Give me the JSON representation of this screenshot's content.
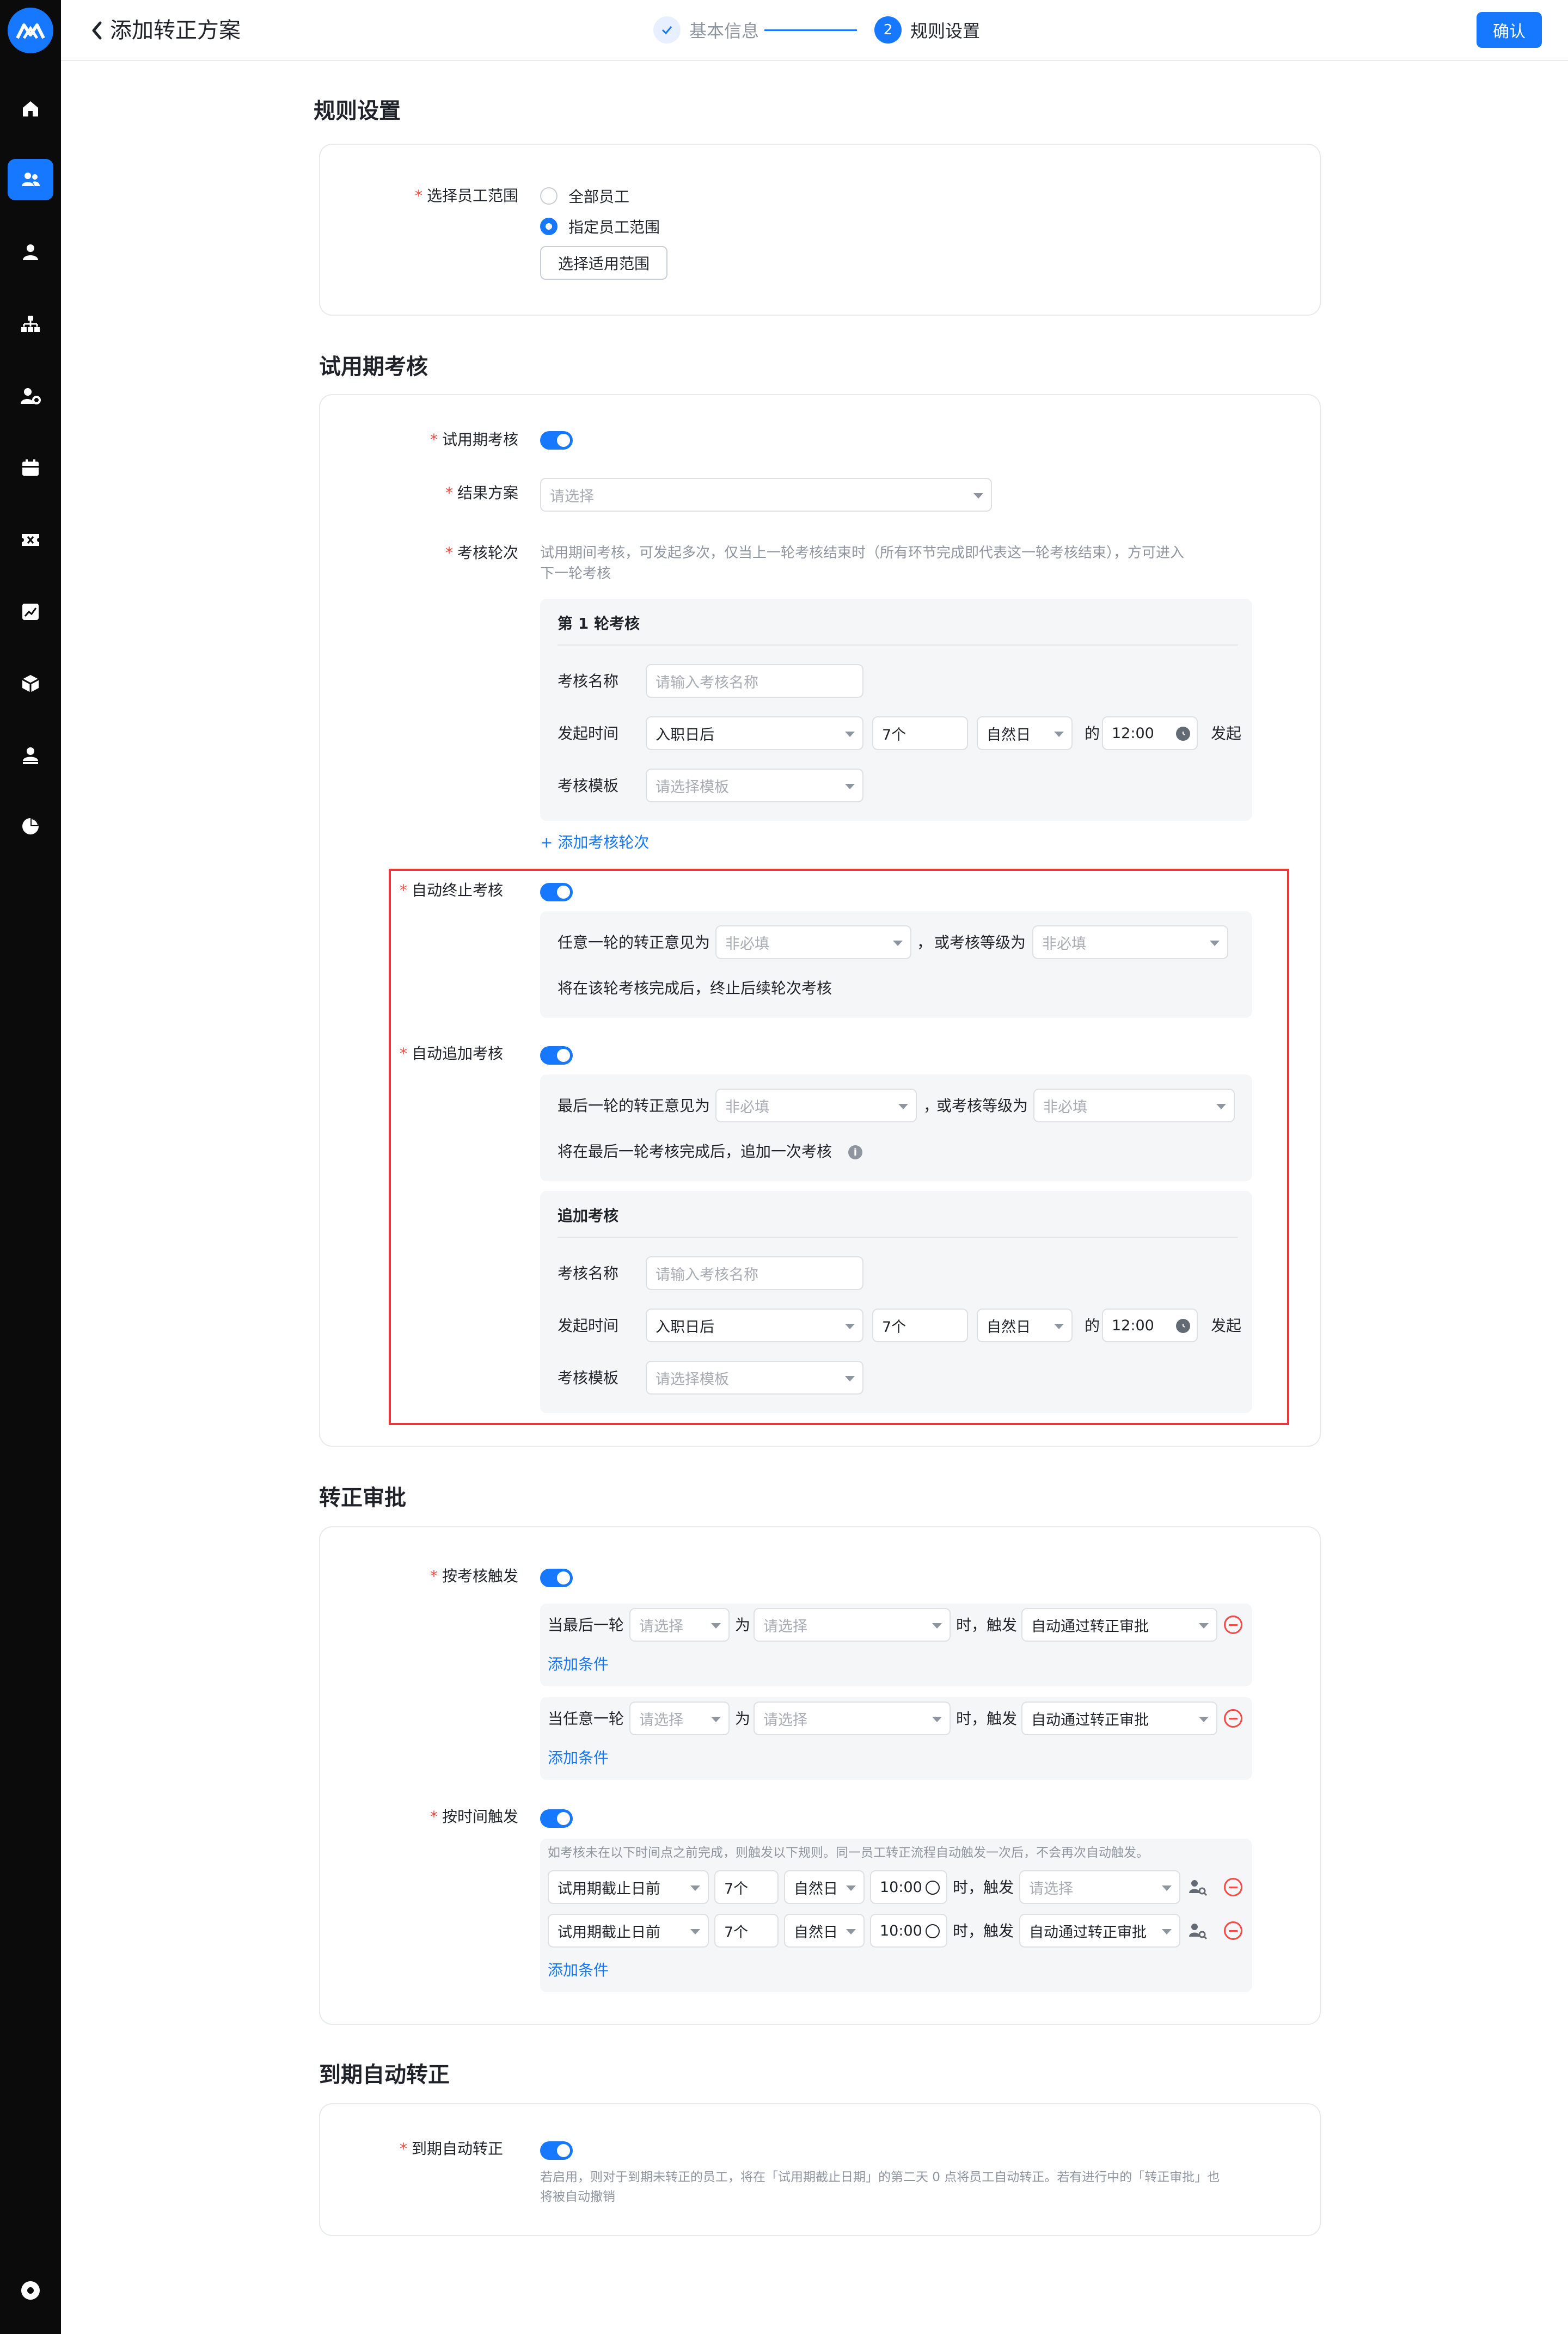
{
  "header": {
    "title": "添加转正方案",
    "step1": "基本信息",
    "step2_num": "2",
    "step2": "规则设置",
    "confirm": "确认"
  },
  "sidebar": {
    "icons": [
      "logo-icon",
      "home-icon",
      "people-icon",
      "person-icon",
      "org-chart-icon",
      "person-settings-icon",
      "calendar-icon",
      "ticket-icon",
      "chart-icon",
      "box-icon",
      "person-badge-icon",
      "pie-chart-icon",
      "settings-icon"
    ]
  },
  "rules": {
    "title": "规则设置",
    "scope_label": "选择员工范围",
    "opt_all": "全部员工",
    "opt_specified": "指定员工范围",
    "scope_btn": "选择适用范围"
  },
  "probation": {
    "title": "试用期考核",
    "review_label": "试用期考核",
    "result_label": "结果方案",
    "result_placeholder": "请选择",
    "rounds_label": "考核轮次",
    "rounds_hint_1": "试用期间考核，可发起多次，仅当上一轮考核结束时（所有环节完成即代表这一轮考核结束），方可进入",
    "rounds_hint_2": "下一轮考核",
    "round1": {
      "title": "第 1 轮考核",
      "name_label": "考核名称",
      "name_placeholder": "请输入考核名称",
      "time_label": "发起时间",
      "time_base": "入职日后",
      "time_count": "7个",
      "time_unit": "自然日",
      "of": "的",
      "time_clock": "12:00",
      "launch": "发起",
      "tpl_label": "考核模板",
      "tpl_placeholder": "请选择模板"
    },
    "add_round": "添加考核轮次",
    "auto_stop_label": "自动终止考核",
    "stop_any": "任意一轮的转正意见为",
    "stop_any_placeholder": "非必填",
    "comma": "，",
    "or_level": "或考核等级为",
    "or_level_placeholder": "非必填",
    "stop_desc": "将在该轮考核完成后，终止后续轮次考核",
    "auto_add_label": "自动追加考核",
    "add_last": "最后一轮的转正意见为",
    "add_last_placeholder": "非必填",
    "add_or_level": "或考核等级为",
    "add_or_level_placeholder": "非必填",
    "add_desc": "将在最后一轮考核完成后，追加一次考核",
    "extra": {
      "title": "追加考核",
      "name_label": "考核名称",
      "name_placeholder": "请输入考核名称",
      "time_label": "发起时间",
      "time_base": "入职日后",
      "time_count": "7个",
      "time_unit": "自然日",
      "of": "的",
      "time_clock": "12:00",
      "launch": "发起",
      "tpl_label": "考核模板",
      "tpl_placeholder": "请选择模板"
    }
  },
  "approval": {
    "title": "转正审批",
    "by_review_label": "按考核触发",
    "cond1": {
      "prefix": "当最后一轮",
      "sel1": "请选择",
      "is": "为",
      "sel2": "请选择",
      "then": "时，触发",
      "action": "自动通过转正审批",
      "add": "添加条件"
    },
    "cond2": {
      "prefix": "当任意一轮",
      "sel1": "请选择",
      "is": "为",
      "sel2": "请选择",
      "then": "时，触发",
      "action": "自动通过转正审批",
      "add": "添加条件"
    },
    "by_time_label": "按时间触发",
    "time_hint": "如考核未在以下时间点之前完成，则触发以下规则。同一员工转正流程自动触发一次后，不会再次自动触发。",
    "trow1": {
      "base": "试用期截止日前",
      "count": "7个",
      "unit": "自然日",
      "clock": "10:00",
      "then": "时，触发",
      "action": "请选择"
    },
    "trow2": {
      "base": "试用期截止日前",
      "count": "7个",
      "unit": "自然日",
      "clock": "10:00",
      "then": "时，触发",
      "action": "自动通过转正审批"
    },
    "add": "添加条件"
  },
  "auto": {
    "title": "到期自动转正",
    "label": "到期自动转正",
    "desc1": "若启用，则对于到期未转正的员工，将在「试用期截止日期」的第二天 0 点将员工自动转正。若有进行中的「转正审批」也",
    "desc2": "将被自动撤销"
  },
  "colors": {
    "accent": "#1677ff",
    "required": "#f54a45",
    "highlight_border": "#e5393e",
    "sidebar_bg": "#0b0b0b"
  }
}
